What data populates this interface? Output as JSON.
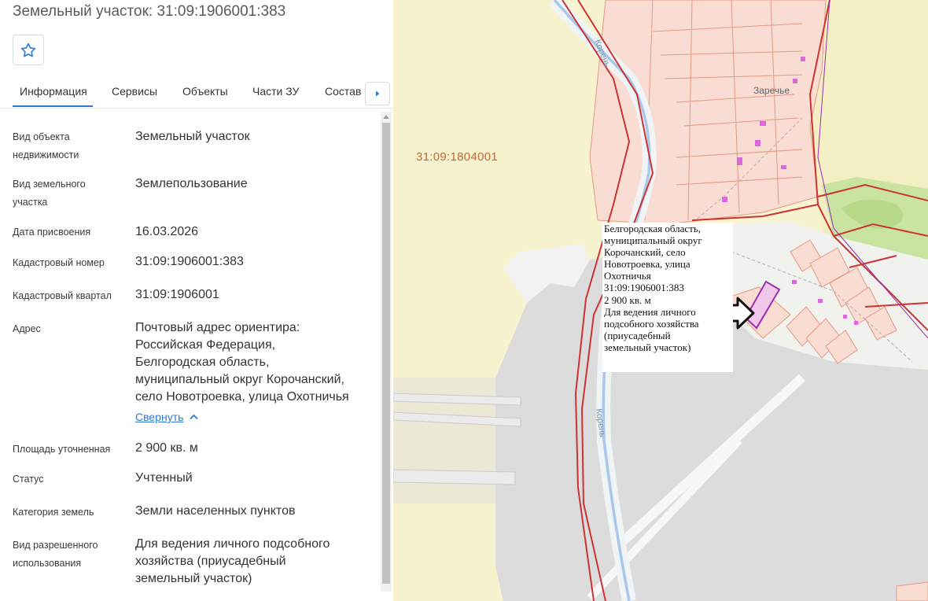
{
  "header": {
    "title": "Земельный участок: 31:09:1906001:383",
    "favorite_icon": "star-outline-icon"
  },
  "tabs": [
    {
      "label": "Информация",
      "active": true
    },
    {
      "label": "Сервисы",
      "active": false
    },
    {
      "label": "Объекты",
      "active": false
    },
    {
      "label": "Части ЗУ",
      "active": false
    },
    {
      "label": "Состав",
      "active": false
    }
  ],
  "tabs_next_icon": "chevron-right-icon",
  "info": [
    {
      "label_lines": [
        "Вид объекта",
        "недвижимости"
      ],
      "value_lines": [
        "Земельный участок"
      ]
    },
    {
      "label_lines": [
        "Вид земельного",
        "участка"
      ],
      "value_lines": [
        "Землепользование"
      ]
    },
    {
      "label_lines": [
        "Дата присвоения"
      ],
      "value_lines": [
        "16.03.2026"
      ]
    },
    {
      "label_lines": [
        "Кадастровый номер"
      ],
      "value_lines": [
        "31:09:1906001:383"
      ]
    },
    {
      "label_lines": [
        "Кадастровый квартал"
      ],
      "value_lines": [
        "31:09:1906001"
      ]
    },
    {
      "label_lines": [
        "Адрес"
      ],
      "value_lines": [
        "Почтовый адрес ориентира:",
        "Российская Федерация,",
        "Белгородская область,",
        "муниципальный округ Корочанский,",
        "село Новотроевка, улица Охотничья"
      ]
    },
    {
      "label_lines": [
        "Площадь уточненная"
      ],
      "value_lines": [
        "2 900 кв. м"
      ]
    },
    {
      "label_lines": [
        "Статус"
      ],
      "value_lines": [
        "Учтенный"
      ]
    },
    {
      "label_lines": [
        "Категория земель"
      ],
      "value_lines": [
        "Земли населенных пунктов"
      ]
    },
    {
      "label_lines": [
        "Вид разрешенного",
        "использования"
      ],
      "value_lines": [
        "Для ведения личного подсобного",
        "хозяйства (приусадебный",
        "земельный участок)"
      ]
    }
  ],
  "collapse_link": "Свернуть",
  "map": {
    "quarter_label": "31:09:1804001",
    "place_label": "Заречье",
    "river_label": "Корень",
    "popup_lines": [
      "Белгородская область,",
      "муниципальный округ",
      "Корочанский, село",
      "Новотроевка, улица",
      "Охотничья",
      "31:09:1906001:383",
      "2 900 кв. м",
      "Для ведения личного",
      "подсобного хозяйства",
      "(приусадебный",
      "земельный участок)"
    ]
  },
  "colors": {
    "accent": "#2b7bd6",
    "map_background": "#f8f3cf",
    "boundary_red": "#cc3333",
    "parcel_fill": "#f9dcd2",
    "selected_parcel": "#9b2fae",
    "forest": "#c9e4a0"
  }
}
